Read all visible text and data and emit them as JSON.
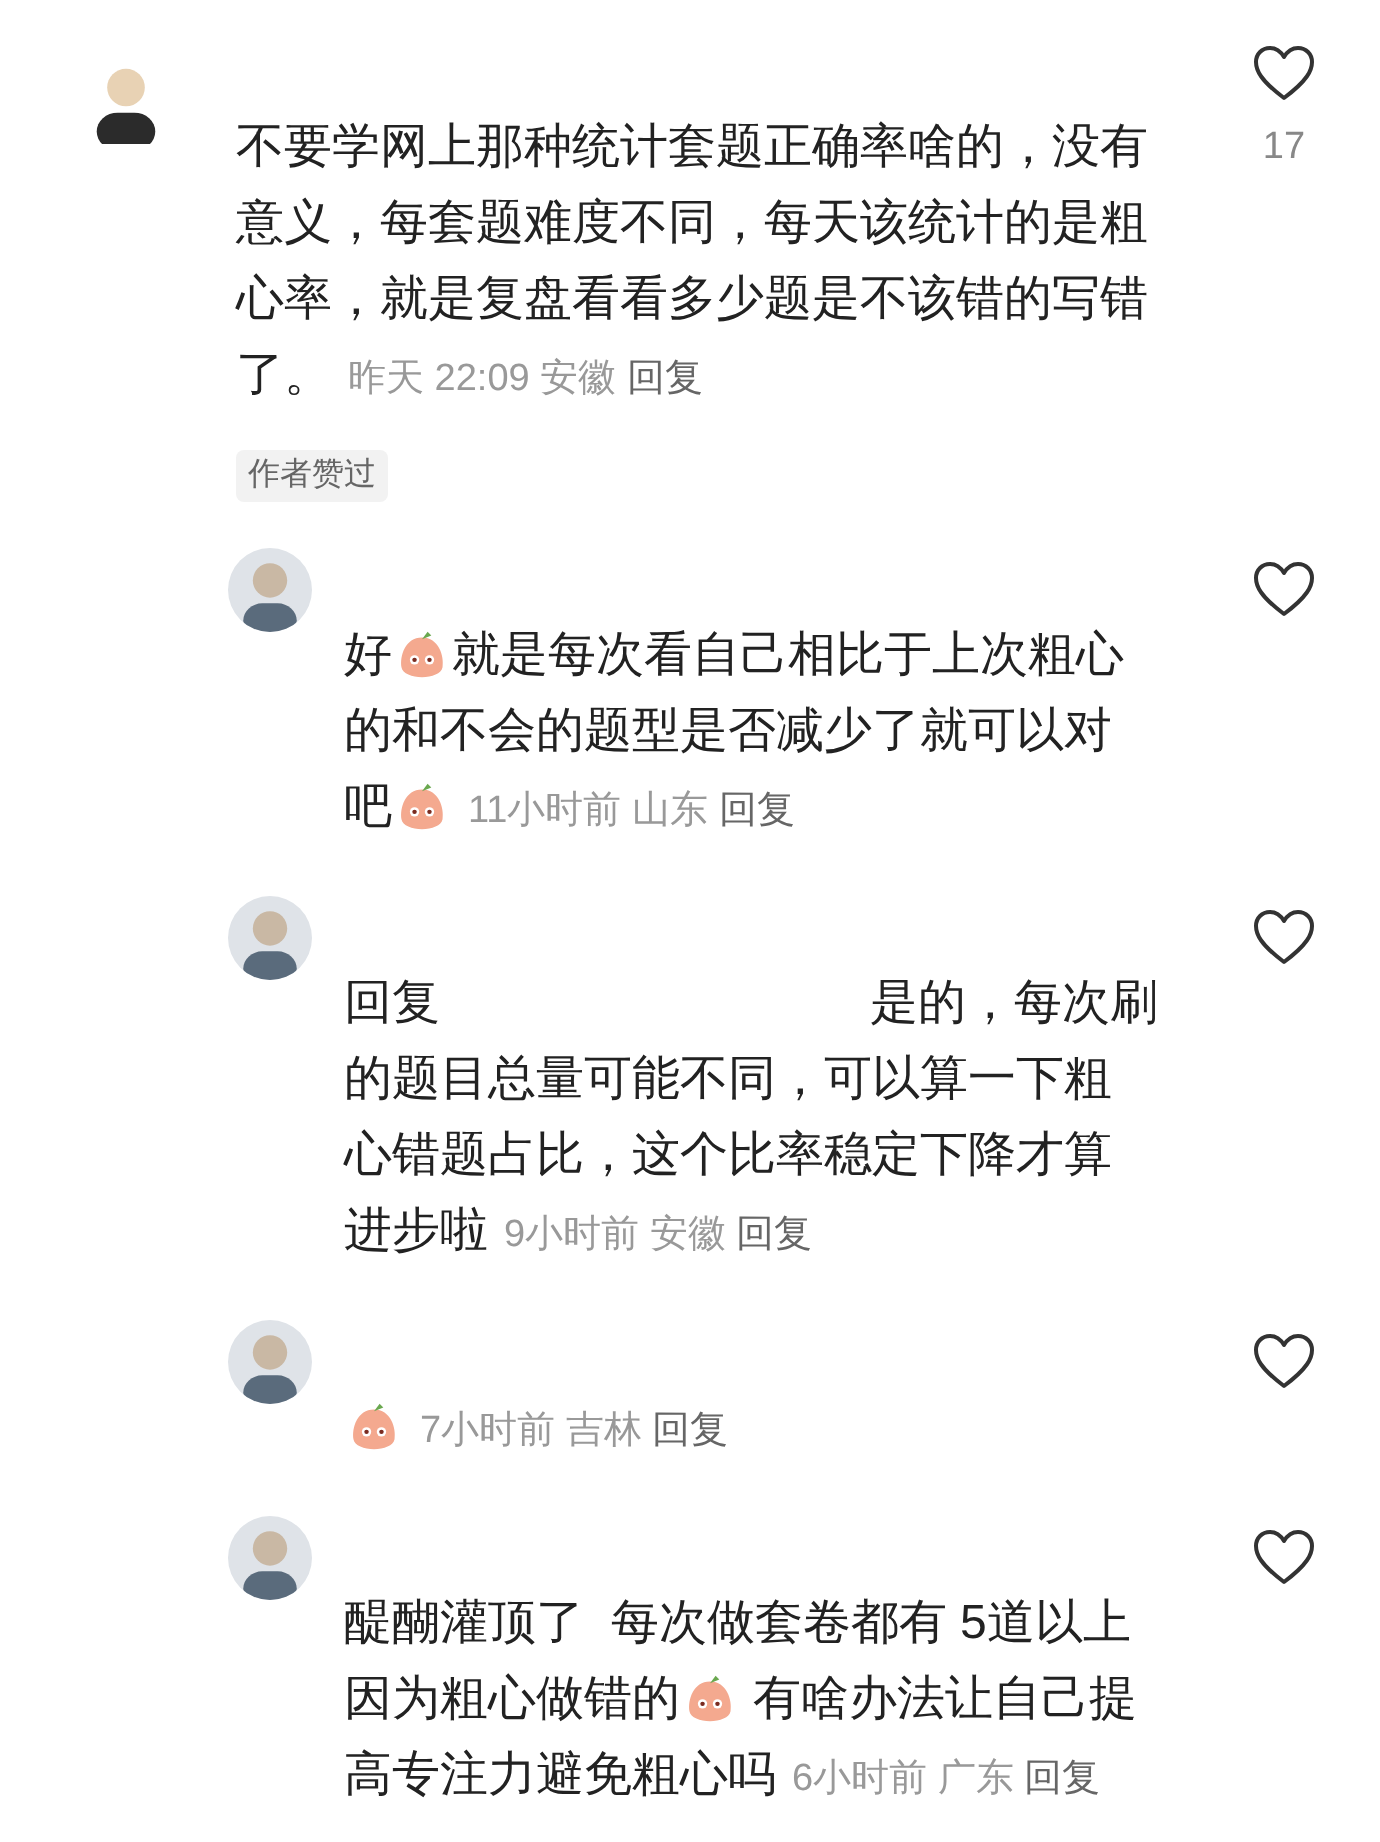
{
  "comment": {
    "like_count": "17",
    "author_liked": "作者赞过",
    "lines": [
      [
        {
          "kind": "text",
          "text": "不要学网上那种统计套题正确率啥的，没有"
        }
      ],
      [
        {
          "kind": "text",
          "text": "意义，每套题难度不同，每天该统计的是粗"
        }
      ],
      [
        {
          "kind": "text",
          "text": "心率，就是复盘看看多少题是不该错的写错"
        }
      ],
      [
        {
          "kind": "text",
          "text": "了。"
        }
      ]
    ],
    "time": "昨天 22:09",
    "location": "安徽",
    "reply": "回复",
    "replies": [
      {
        "lines": [
          [
            {
              "kind": "text",
              "text": "好"
            },
            {
              "kind": "emoji"
            },
            {
              "kind": "text",
              "text": "就是每次看自己相比于上次粗心"
            }
          ],
          [
            {
              "kind": "text",
              "text": "的和不会的题型是否减少了就可以对"
            }
          ],
          [
            {
              "kind": "text",
              "text": "吧"
            },
            {
              "kind": "emoji"
            }
          ]
        ],
        "time": "11小时前",
        "location": "山东",
        "reply": "回复"
      },
      {
        "lines": [
          [
            {
              "kind": "text",
              "text": "回复"
            },
            {
              "kind": "gap"
            },
            {
              "kind": "text",
              "text": "是的，每次刷"
            }
          ],
          [
            {
              "kind": "text",
              "text": "的题目总量可能不同，可以算一下粗"
            }
          ],
          [
            {
              "kind": "text",
              "text": "心错题占比，这个比率稳定下降才算"
            }
          ],
          [
            {
              "kind": "text",
              "text": "进步啦"
            }
          ]
        ],
        "time": "9小时前",
        "location": "安徽",
        "reply": "回复"
      },
      {
        "lines": [
          [
            {
              "kind": "emoji"
            }
          ]
        ],
        "time": "7小时前",
        "location": "吉林",
        "reply": "回复"
      },
      {
        "lines": [
          [
            {
              "kind": "text",
              "text": "醍醐灌顶了  每次做套卷都有 5道以上"
            }
          ],
          [
            {
              "kind": "text",
              "text": "因为粗心做错的"
            },
            {
              "kind": "emoji"
            },
            {
              "kind": "text",
              "text": " 有啥办法让自己提"
            }
          ],
          [
            {
              "kind": "text",
              "text": "高专注力避免粗心吗"
            }
          ]
        ],
        "time": "6小时前",
        "location": "广东",
        "reply": "回复"
      }
    ]
  }
}
